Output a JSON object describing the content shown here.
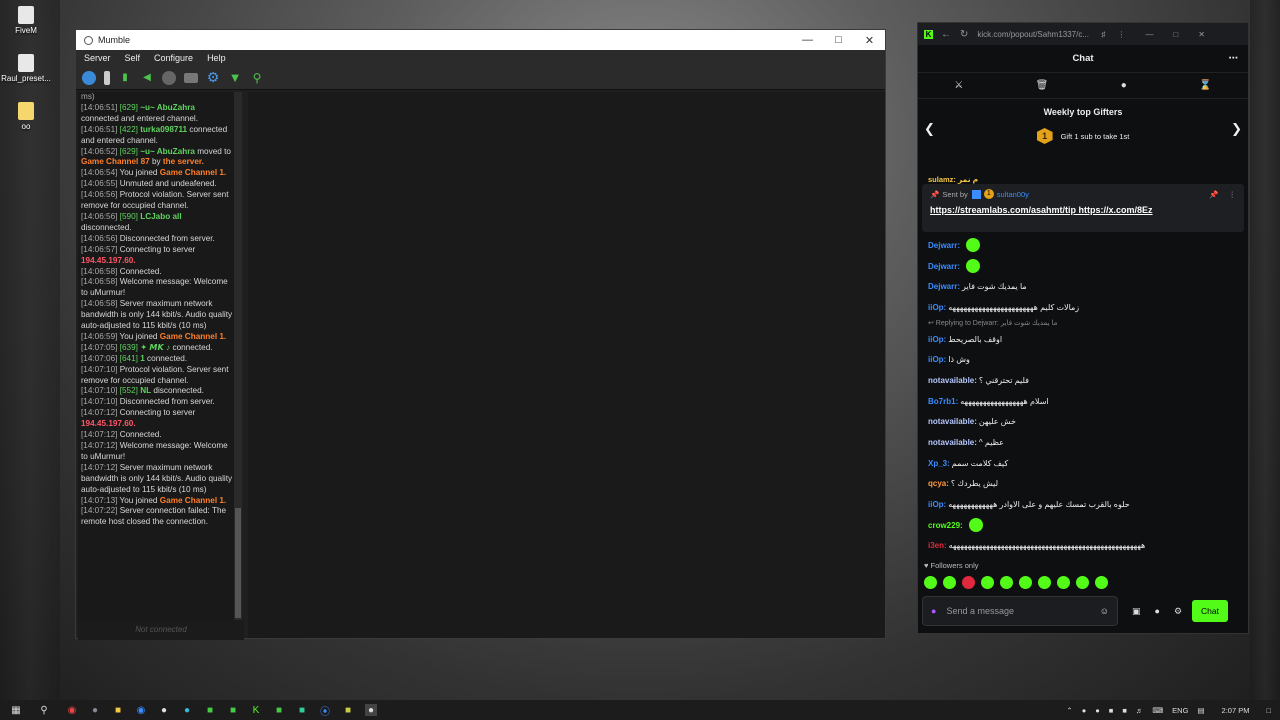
{
  "desktop": {
    "icons": [
      {
        "label": "FiveM"
      },
      {
        "label": "Raul_preset..."
      },
      {
        "label": "oo"
      }
    ]
  },
  "mumble": {
    "title": "Mumble",
    "menu": [
      "Server",
      "Self",
      "Configure",
      "Help"
    ],
    "status": "Not connected",
    "log": [
      {
        "t": "ms)"
      },
      {
        "t": "[14:06:51] ",
        "n": "[629] ",
        "u": "~u~ AbuZahra",
        "r": " connected and entered channel."
      },
      {
        "t": "[14:06:51] ",
        "n": "[422] ",
        "u": "turka098711",
        "r": " connected and entered channel."
      },
      {
        "t": "[14:06:52] ",
        "n": "[629] ",
        "u": "~u~ AbuZahra",
        "r": " moved to ",
        "c": "Game Channel 87",
        "r2": " by ",
        "c2": "the server."
      },
      {
        "t": "[14:06:54] ",
        "r": "You joined ",
        "c": "Game Channel 1."
      },
      {
        "t": "[14:06:55] ",
        "r": "Unmuted and undeafened."
      },
      {
        "t": "[14:06:56] ",
        "r": "Protocol violation. Server sent remove for occupied channel."
      },
      {
        "t": "[14:06:56] ",
        "n": "[590] ",
        "u": "LCJabo all",
        "r": " disconnected."
      },
      {
        "t": "[14:06:56] ",
        "r": "Disconnected from server."
      },
      {
        "t": "[14:06:57] ",
        "r": "Connecting to server ",
        "ip": "194.45.197.60."
      },
      {
        "t": "[14:06:58] ",
        "r": "Connected."
      },
      {
        "t": "[14:06:58] ",
        "r": "Welcome message: Welcome to uMurmur!"
      },
      {
        "t": "[14:06:58] ",
        "r": "Server maximum network bandwidth is only 144 kbit/s. Audio quality auto-adjusted to 115 kbit/s (10 ms)"
      },
      {
        "t": "[14:06:59] ",
        "r": "You joined ",
        "c": "Game Channel 1."
      },
      {
        "t": "[14:07:05] ",
        "n": "[639] ",
        "u": "✦ 𝙈𝙆 ♪",
        "r": " connected."
      },
      {
        "t": "[14:07:06] ",
        "n": "[641] ",
        "u": "1",
        "r": " connected."
      },
      {
        "t": "[14:07:10] ",
        "r": "Protocol violation. Server sent remove for occupied channel."
      },
      {
        "t": "[14:07:10] ",
        "n": "[552] ",
        "u": "NL",
        "r": " disconnected."
      },
      {
        "t": "[14:07:10] ",
        "r": "Disconnected from server."
      },
      {
        "t": "[14:07:12] ",
        "r": "Connecting to server ",
        "ip": "194.45.197.60."
      },
      {
        "t": "[14:07:12] ",
        "r": "Connected."
      },
      {
        "t": "[14:07:12] ",
        "r": "Welcome message: Welcome to uMurmur!"
      },
      {
        "t": "[14:07:12] ",
        "r": "Server maximum network bandwidth is only 144 kbit/s. Audio quality auto-adjusted to 115 kbit/s (10 ms)"
      },
      {
        "t": "[14:07:13] ",
        "r": "You joined ",
        "c": "Game Channel 1."
      },
      {
        "t": "[14:07:22] ",
        "r": "Server connection failed: The remote host closed the connection."
      }
    ]
  },
  "kick": {
    "url": "kick.com/popout/Sahm1337/c...",
    "chat_title": "Chat",
    "gifters_title": "Weekly top Gifters",
    "gift_text": "Gift 1 sub to take 1st",
    "medal": "1",
    "pinned_by": "Sent by",
    "pinned_badge": "1",
    "pinned_user": "sultan00y",
    "pinned_links": "https://streamlabs.com/asahmt/tip https://x.com/8Ez",
    "partial_top": "sulamz: م نمر",
    "messages": [
      {
        "user": "Dejwarr",
        "color": "#3b8cff",
        "text": "",
        "emote": true
      },
      {
        "user": "Dejwarr",
        "color": "#3b8cff",
        "text": "",
        "emote": true
      },
      {
        "user": "Dejwarr",
        "color": "#3b8cff",
        "text": "ما يمديك شوت فاير"
      },
      {
        "user": "iiOp",
        "color": "#3b8cff",
        "text": "زمالات كليم هههههههههههههههههههههههه"
      },
      {
        "reply": "Replying to Dejwarr: ما يمديك شوت فاير"
      },
      {
        "user": "iiOp",
        "color": "#3b8cff",
        "text": "اوقف بالصريحط"
      },
      {
        "user": "iiOp",
        "color": "#3b8cff",
        "text": "وش ذا"
      },
      {
        "user": "notavailable",
        "color": "#b4c8ff",
        "text": "فليم تحترقني ؟"
      },
      {
        "user": "Bo7rb1",
        "color": "#3b8cff",
        "text": "اسلام هههههههههههههههههه"
      },
      {
        "user": "notavailable",
        "color": "#b4c8ff",
        "text": "خش عليهن"
      },
      {
        "user": "notavailable",
        "color": "#b4c8ff",
        "text": "عظيم ^"
      },
      {
        "user": "Xp_3",
        "color": "#3b8cff",
        "text": "كيف كلامت سمم"
      },
      {
        "user": "qcya",
        "color": "#ff9a3c",
        "text": "ليش يطردك ؟"
      },
      {
        "user": "iiOp",
        "color": "#3b8cff",
        "text": "حلوه بالقرب تمسك عليهم و على الاوادر ههههههههههههه"
      },
      {
        "user": "crow229",
        "color": "#53fc18",
        "text": "",
        "emote": true
      },
      {
        "user": "i3en",
        "color": "#e0293c",
        "text": "ههههههههههههههههههههههههههههههههههههههههههههههههههههه"
      }
    ],
    "followers_only": "Followers only",
    "input_placeholder": "Send a message",
    "chat_button": "Chat"
  },
  "taskbar": {
    "lang": "ENG",
    "time": "2:07 PM"
  }
}
